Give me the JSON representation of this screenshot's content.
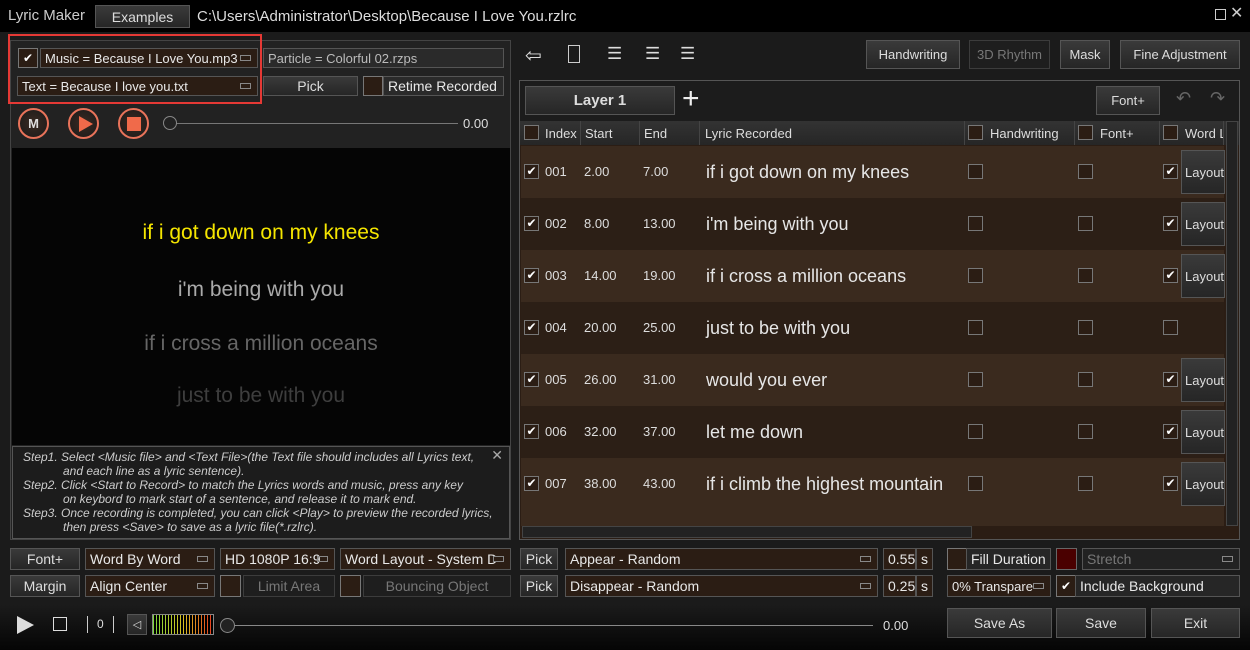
{
  "title": "Lyric Maker",
  "examples": "Examples",
  "path": "C:\\Users\\Administrator\\Desktop\\Because I Love You.rzlrc",
  "left": {
    "music": "Music = Because I Love You.mp3",
    "particle": "Particle = Colorful 02.rzps",
    "text": "Text = Because I love you.txt",
    "pick": "Pick",
    "retime": "Retime Recorded",
    "m": "M",
    "time": "0.00",
    "preview": [
      "if i got down on my knees",
      "i'm being with you",
      "if i cross a million oceans",
      "just to be with you"
    ],
    "steps": [
      "Step1. Select <Music file> and <Text File>(the Text file should includes all Lyrics text,",
      "and each line as a lyric sentence).",
      "Step2. Click <Start to Record> to match the Lyrics words and music, press any key",
      "on keybord to mark start of a sentence, and release it to mark end.",
      "Step3. Once recording is completed, you can click <Play> to preview the recorded lyrics,",
      "then press <Save> to save as a lyric file(*.rzlrc)."
    ],
    "font": "Font+",
    "mode": "Word By Word",
    "res": "HD 1080P 16:9",
    "layout": "Word Layout - System D",
    "margin": "Margin",
    "align": "Align Center",
    "limit": "Limit Area",
    "bounce": "Bouncing Object"
  },
  "toolbar": {
    "handwriting": "Handwriting",
    "rhythm": "3D Rhythm",
    "mask": "Mask",
    "fine": "Fine Adjustment"
  },
  "layer": {
    "name": "Layer 1",
    "font": "Font+"
  },
  "columns": [
    "Index",
    "Start",
    "End",
    "Lyric Recorded",
    "Handwriting",
    "Font+",
    "Word L"
  ],
  "rows": [
    {
      "i": "001",
      "s": "2.00",
      "e": "7.00",
      "l": "if i got down on my knees",
      "wl": true,
      "btn": "Layout"
    },
    {
      "i": "002",
      "s": "8.00",
      "e": "13.00",
      "l": "i'm being with you",
      "wl": true,
      "btn": "Layout"
    },
    {
      "i": "003",
      "s": "14.00",
      "e": "19.00",
      "l": "if i cross a million oceans",
      "wl": true,
      "btn": "Layout"
    },
    {
      "i": "004",
      "s": "20.00",
      "e": "25.00",
      "l": "just to be with you",
      "wl": false,
      "btn": ""
    },
    {
      "i": "005",
      "s": "26.00",
      "e": "31.00",
      "l": "would you ever",
      "wl": true,
      "btn": "Layout"
    },
    {
      "i": "006",
      "s": "32.00",
      "e": "37.00",
      "l": "let me down",
      "wl": true,
      "btn": "Layout"
    },
    {
      "i": "007",
      "s": "38.00",
      "e": "43.00",
      "l": "if i climb the highest mountain",
      "wl": true,
      "btn": "Layout"
    }
  ],
  "effects": {
    "pick": "Pick",
    "appear": "Appear - Random",
    "appear_s": "0.55",
    "disappear": "Disappear - Random",
    "disappear_s": "0.25",
    "unit": "s",
    "fill": "Fill Duration",
    "stretch": "Stretch",
    "transp": "0% Transpare",
    "incbg": "Include Background"
  },
  "bottom": {
    "count": "0",
    "time": "0.00",
    "saveas": "Save As",
    "save": "Save",
    "exit": "Exit"
  }
}
